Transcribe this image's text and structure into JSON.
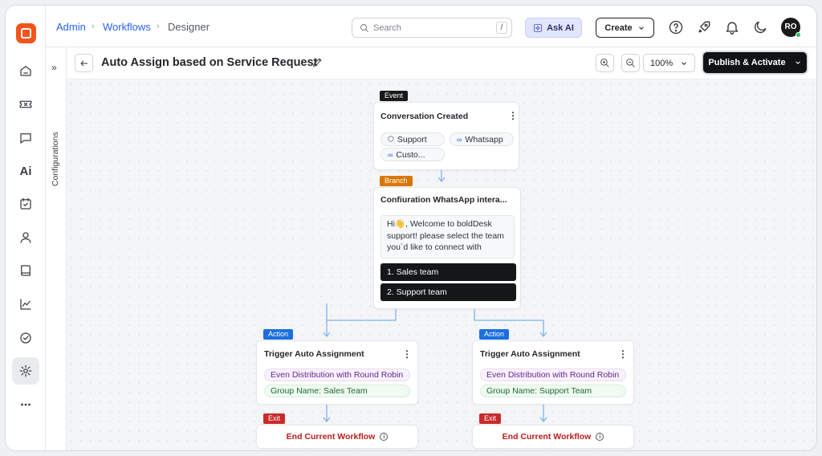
{
  "breadcrumb": {
    "admin": "Admin",
    "workflows": "Workflows",
    "designer": "Designer"
  },
  "search": {
    "placeholder": "Search",
    "shortcut": "/"
  },
  "header": {
    "ask_ai": "Ask AI",
    "create": "Create",
    "avatar_initials": "RO"
  },
  "sidebar": {
    "items": [
      {
        "icon": "home-icon"
      },
      {
        "icon": "ticket-icon"
      },
      {
        "icon": "chat-icon"
      },
      {
        "icon": "ai-icon",
        "text": "Ai"
      },
      {
        "icon": "calendar-check-icon"
      },
      {
        "icon": "user-icon"
      },
      {
        "icon": "book-icon"
      },
      {
        "icon": "chart-icon"
      },
      {
        "icon": "check-circle-icon"
      },
      {
        "icon": "settings-icon",
        "active": true
      },
      {
        "icon": "more-icon"
      }
    ],
    "expand_glyph": "»",
    "configurations_label": "Configurations"
  },
  "toolbar": {
    "title": "Auto Assign based on Service Request",
    "zoom": "100%",
    "publish": "Publish & Activate"
  },
  "flow": {
    "event": {
      "tag": "Event",
      "title": "Conversation Created",
      "chips": [
        {
          "icon": "⬡",
          "label": "Support"
        },
        {
          "icon": "∞",
          "label": "Whatsapp"
        },
        {
          "icon": "∞",
          "label": "Custo..."
        }
      ]
    },
    "branch": {
      "tag": "Branch",
      "title": "Confiuration WhatsApp intera...",
      "message_lines": [
        "Hi👋, Welcome to boldDesk",
        "support! please select the team",
        "you`d like to connect with"
      ],
      "options": [
        "1. Sales team",
        "2. Support team"
      ]
    },
    "actions": [
      {
        "tag": "Action",
        "title": "Trigger Auto Assignment",
        "distribution": "Even Distribution with Round Robin",
        "group": "Group Name: Sales Team",
        "exit_tag": "Exit",
        "exit_label": "End Current Workflow"
      },
      {
        "tag": "Action",
        "title": "Trigger Auto Assignment",
        "distribution": "Even Distribution with Round Robin",
        "group": "Group Name: Support Team",
        "exit_tag": "Exit",
        "exit_label": "End Current Workflow"
      }
    ]
  },
  "colors": {
    "event_tag": "#1a1a1a",
    "branch_tag": "#d97706",
    "action_tag": "#1d6fe0",
    "exit_tag": "#c92a2a",
    "connector": "#7fb3ea"
  }
}
